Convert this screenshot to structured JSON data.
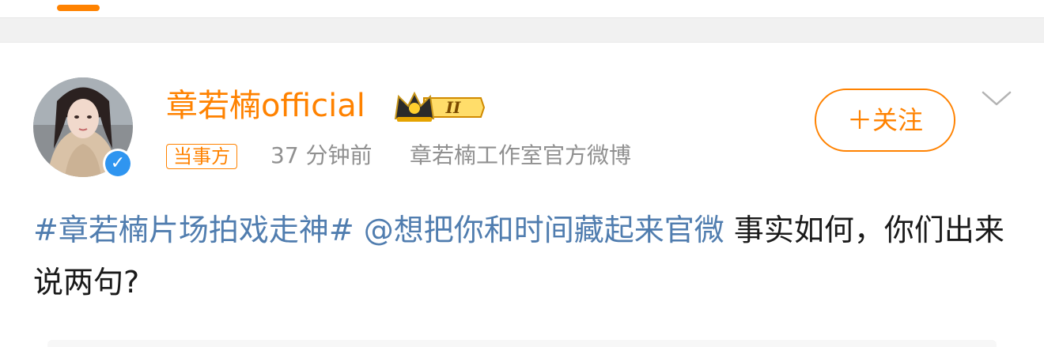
{
  "post": {
    "author": "章若楠official",
    "member_badge": "II",
    "party_tag": "当事方",
    "time": "37 分钟前",
    "source": "章若楠工作室官方微博",
    "follow_label": "＋关注",
    "topic": "#章若楠片场拍戏走神#",
    "mention": "@想把你和时间藏起来官微",
    "text_line1": "事实",
    "text_line2": "如何，你们出来说两句?"
  },
  "icons": {
    "verified": "verified-badge-icon",
    "crown": "vip-crown-icon",
    "more": "chevron-down-icon"
  },
  "colors": {
    "accent": "#ff8200",
    "link": "#507daf",
    "verified": "#2f95f0",
    "meta": "#909090"
  }
}
